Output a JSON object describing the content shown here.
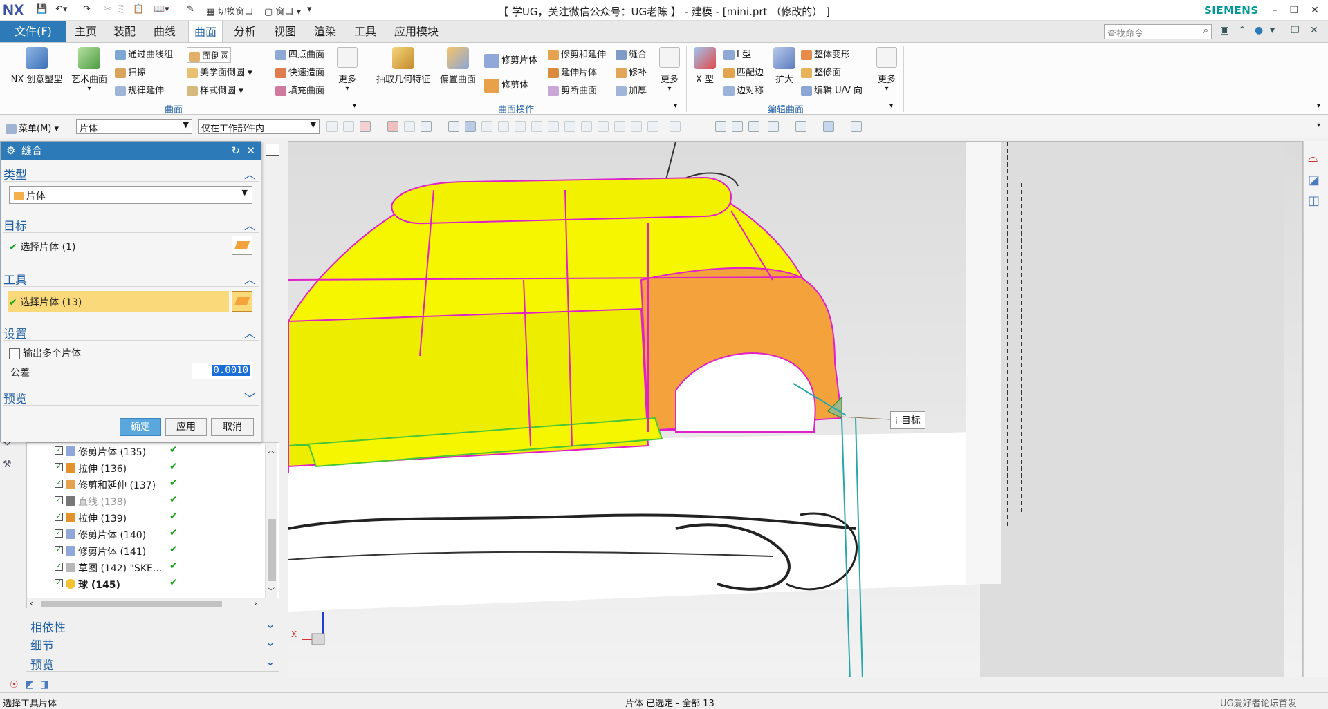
{
  "app": {
    "logo": "NX",
    "window_title": "【 学UG，关注微信公众号：UG老陈 】 - 建模 - [mini.prt （修改的） ]",
    "vendor": "SIEMENS",
    "quick_access": {
      "switch_window": "切换窗口",
      "window_menu": "窗口"
    }
  },
  "menu_tabs": [
    {
      "label": "文件(F)"
    },
    {
      "label": "主页"
    },
    {
      "label": "装配"
    },
    {
      "label": "曲线"
    },
    {
      "label": "曲面"
    },
    {
      "label": "分析"
    },
    {
      "label": "视图"
    },
    {
      "label": "渲染"
    },
    {
      "label": "工具"
    },
    {
      "label": "应用模块"
    }
  ],
  "command_search": {
    "placeholder": "查找命令"
  },
  "ribbon": {
    "groups": {
      "surface": "曲面",
      "surface_ops": "曲面操作",
      "edit_surface": "编辑曲面"
    },
    "surface": {
      "nx_creative": "NX 创意塑型",
      "studio_surface": "艺术曲面",
      "through_curve_mesh": "通过曲线组",
      "sweep": "扫掠",
      "law_extension": "规律延伸",
      "face_blend": "面倒圆",
      "aesthetic_blend": "美学面倒圆",
      "styled_blend": "样式倒圆",
      "four_point": "四点曲面",
      "rapid_surface": "快速造面",
      "fill_surface": "填充曲面",
      "more": "更多"
    },
    "surface_ops": {
      "extract_geometry": "抽取几何特征",
      "offset_surface": "偏置曲面",
      "trim_sheet": "修剪片体",
      "trim_body": "修剪体",
      "trim_extend": "修剪和延伸",
      "extend_sheet": "延伸片体",
      "split_face": "剪断曲面",
      "sew": "缝合",
      "patch": "修补",
      "thicken": "加厚",
      "more": "更多"
    },
    "edit_surface": {
      "x_form": "X 型",
      "i_form": "I 型",
      "match_edge": "匹配边",
      "edge_symmetry": "边对称",
      "enlarge": "扩大",
      "global_shaping": "整体变形",
      "refit_face": "整修面",
      "edit_uv": "编辑 U/V 向",
      "more": "更多"
    }
  },
  "toolbar2": {
    "menu_label": "菜单(M)",
    "selection_filter": "片体",
    "selection_scope": "仅在工作部件内"
  },
  "sew_dialog": {
    "title": "缝合",
    "type_header": "类型",
    "type_value": "片体",
    "target_header": "目标",
    "target_select": "选择片体 (1)",
    "tool_header": "工具",
    "tool_select": "选择片体 (13)",
    "settings_header": "设置",
    "output_multiple": "输出多个片体",
    "tolerance_label": "公差",
    "tolerance_value": "0.0010",
    "preview_header": "预览",
    "ok": "确定",
    "apply": "应用",
    "cancel": "取消"
  },
  "part_navigator": {
    "rows": [
      {
        "label": "修剪片体 (135)",
        "icon": "trim-sheet-icon",
        "greyed": false,
        "bold": false
      },
      {
        "label": "拉伸 (136)",
        "icon": "extrude-icon",
        "greyed": false,
        "bold": false
      },
      {
        "label": "修剪和延伸 (137)",
        "icon": "trim-extend-icon",
        "greyed": false,
        "bold": false
      },
      {
        "label": "直线 (138)",
        "icon": "line-icon",
        "greyed": true,
        "bold": false
      },
      {
        "label": "拉伸 (139)",
        "icon": "extrude-icon",
        "greyed": false,
        "bold": false
      },
      {
        "label": "修剪片体 (140)",
        "icon": "trim-sheet-icon",
        "greyed": false,
        "bold": false
      },
      {
        "label": "修剪片体 (141)",
        "icon": "trim-sheet-icon",
        "greyed": false,
        "bold": false
      },
      {
        "label": "草图 (142) \"SKE...",
        "icon": "sketch-icon",
        "greyed": false,
        "bold": false
      },
      {
        "label": "球 (145)",
        "icon": "sphere-icon",
        "greyed": false,
        "bold": true
      }
    ],
    "panels": {
      "dependencies": "相依性",
      "details": "细节",
      "preview": "预览"
    }
  },
  "viewport": {
    "target_label": "目标",
    "axis_x": "X"
  },
  "status": {
    "prompt": "选择工具片体",
    "selection_info": "片体 已选定 - 全部 13",
    "watermark": "UG爱好者论坛首发"
  },
  "colors": {
    "accent": "#2c7ab8",
    "surface_yellow": "#f6f600",
    "surface_orange": "#f4a23c",
    "edge_magenta": "#e020c8",
    "check_green": "#18a018",
    "selected_row": "#fad97a"
  }
}
